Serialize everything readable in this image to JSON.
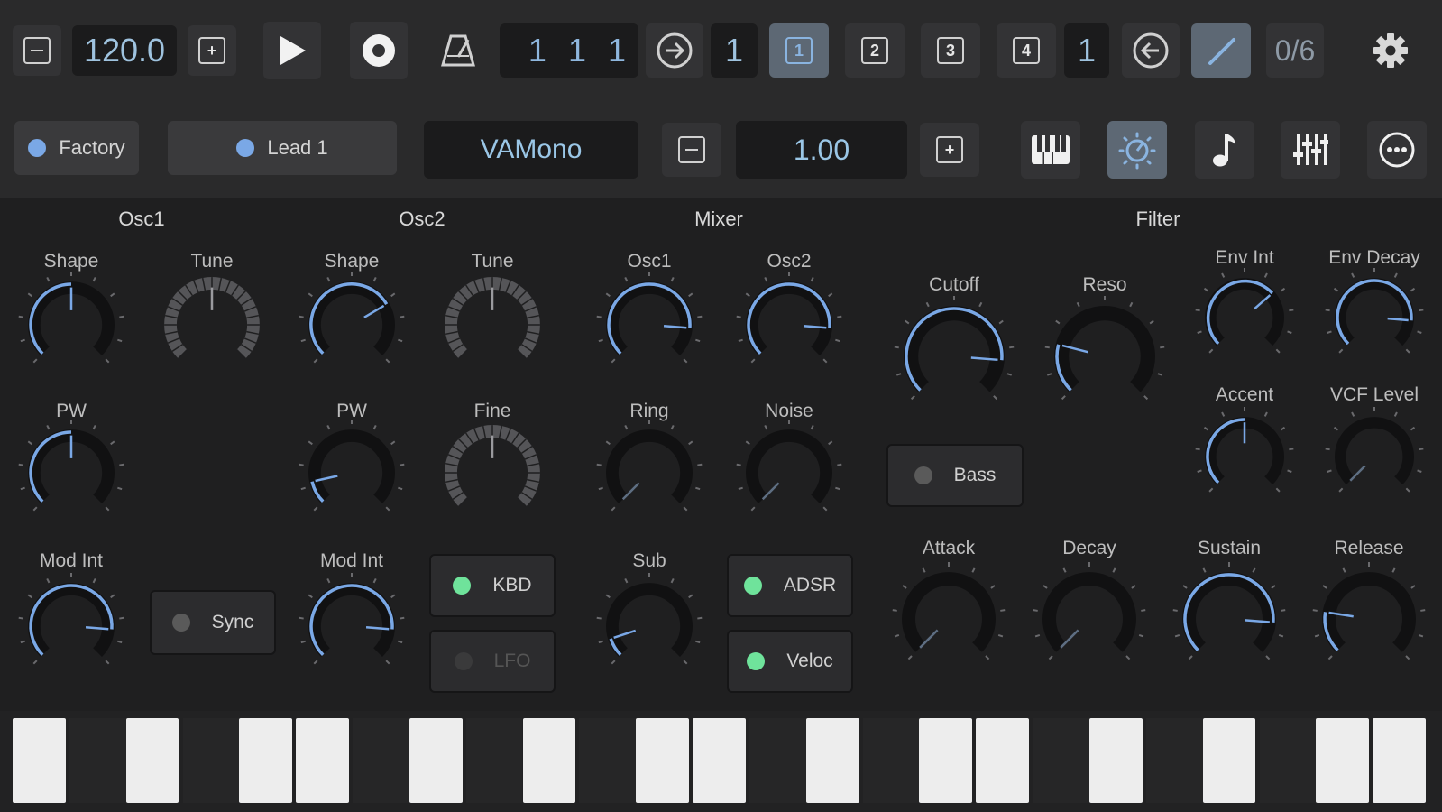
{
  "transport": {
    "tempo": "120.0",
    "position": "1 1 1",
    "loop_value": "1",
    "scenes": [
      "1",
      "2",
      "3",
      "4"
    ],
    "scene_count": "1",
    "voices": "0/6"
  },
  "instrument": {
    "bank": "Factory",
    "preset": "Lead 1",
    "engine": "VAMono",
    "value": "1.00"
  },
  "sections": {
    "osc1": "Osc1",
    "osc2": "Osc2",
    "mixer": "Mixer",
    "filter": "Filter"
  },
  "knobs": {
    "osc1_shape": {
      "label": "Shape",
      "level": 0.5
    },
    "osc1_tune": {
      "label": "Tune",
      "level": 0.5
    },
    "osc2_shape": {
      "label": "Shape",
      "level": 0.72
    },
    "osc2_tune": {
      "label": "Tune",
      "level": 0.5
    },
    "mix_osc1": {
      "label": "Osc1",
      "level": 0.85
    },
    "mix_osc2": {
      "label": "Osc2",
      "level": 0.85
    },
    "osc1_pw": {
      "label": "PW",
      "level": 0.5
    },
    "osc2_pw": {
      "label": "PW",
      "level": 0.12
    },
    "osc2_fine": {
      "label": "Fine",
      "level": 0.5
    },
    "mix_ring": {
      "label": "Ring",
      "level": 0.0
    },
    "mix_noise": {
      "label": "Noise",
      "level": 0.0
    },
    "osc1_modint": {
      "label": "Mod Int",
      "level": 0.85
    },
    "osc2_modint": {
      "label": "Mod Int",
      "level": 0.85
    },
    "mix_sub": {
      "label": "Sub",
      "level": 0.1
    },
    "cutoff": {
      "label": "Cutoff",
      "level": 0.85
    },
    "reso": {
      "label": "Reso",
      "level": 0.22
    },
    "env_int": {
      "label": "Env Int",
      "level": 0.68
    },
    "env_decay": {
      "label": "Env Decay",
      "level": 0.85
    },
    "accent": {
      "label": "Accent",
      "level": 0.5
    },
    "vcf_level": {
      "label": "VCF Level",
      "level": 0.0
    },
    "attack": {
      "label": "Attack",
      "level": 0.0
    },
    "decay": {
      "label": "Decay",
      "level": 0.0
    },
    "sustain": {
      "label": "Sustain",
      "level": 0.85
    },
    "release": {
      "label": "Release",
      "level": 0.2
    }
  },
  "toggles": {
    "sync": {
      "label": "Sync",
      "on": false
    },
    "kbd": {
      "label": "KBD",
      "on": true
    },
    "lfo": {
      "label": "LFO",
      "on": false
    },
    "adsr": {
      "label": "ADSR",
      "on": true
    },
    "veloc": {
      "label": "Veloc",
      "on": true
    },
    "bass": {
      "label": "Bass",
      "on": false
    }
  },
  "colors": {
    "accent": "#7aa8e6",
    "led_on": "#6fe39b",
    "led_off": "#5a5a5a"
  },
  "icons": {
    "tempo_minus": "minus-square-icon",
    "tempo_plus": "plus-square-icon",
    "play": "play-icon",
    "record": "record-icon",
    "metronome": "metronome-icon",
    "forward": "arrow-right-circle-icon",
    "back": "arrow-left-circle-icon",
    "draw": "pencil-icon",
    "settings": "gear-icon",
    "keyboard": "piano-icon",
    "synth": "sun-dial-icon",
    "note": "music-note-icon",
    "mixer": "sliders-icon",
    "more": "more-circle-icon"
  }
}
